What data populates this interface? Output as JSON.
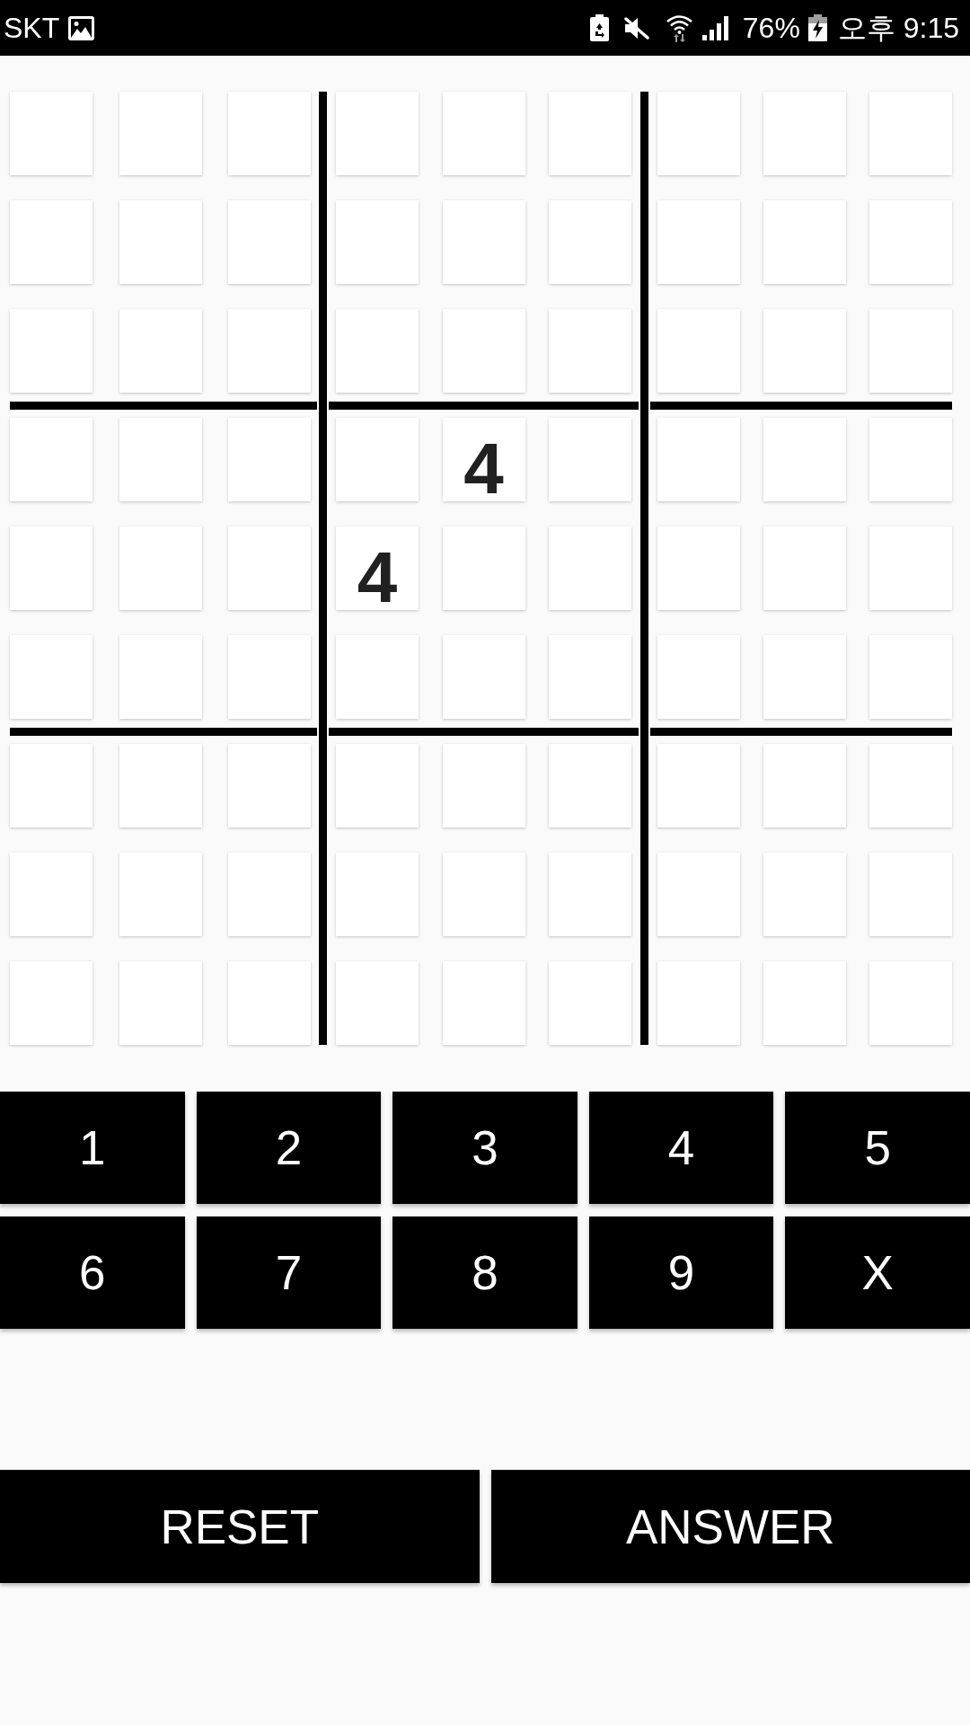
{
  "status_bar": {
    "carrier": "SKT",
    "battery_percent": "76%",
    "time": "오후 9:15"
  },
  "board": {
    "rows": [
      {
        "cells": [
          {
            "kind": "empty"
          },
          {
            "kind": "empty"
          },
          {
            "kind": "empty"
          },
          {
            "kind": "empty"
          },
          {
            "kind": "empty"
          },
          {
            "kind": "empty"
          },
          {
            "kind": "empty"
          },
          {
            "kind": "empty"
          },
          {
            "kind": "empty"
          }
        ]
      },
      {
        "cells": [
          {
            "kind": "empty"
          },
          {
            "kind": "empty"
          },
          {
            "kind": "empty"
          },
          {
            "kind": "empty"
          },
          {
            "kind": "empty"
          },
          {
            "kind": "empty"
          },
          {
            "kind": "empty"
          },
          {
            "kind": "empty"
          },
          {
            "kind": "empty"
          }
        ]
      },
      {
        "cells": [
          {
            "kind": "empty"
          },
          {
            "kind": "empty"
          },
          {
            "kind": "empty"
          },
          {
            "kind": "empty"
          },
          {
            "kind": "empty"
          },
          {
            "kind": "empty"
          },
          {
            "kind": "empty"
          },
          {
            "kind": "empty"
          },
          {
            "kind": "empty"
          }
        ]
      },
      {
        "cells": [
          {
            "kind": "empty"
          },
          {
            "kind": "empty"
          },
          {
            "kind": "empty"
          },
          {
            "kind": "empty"
          },
          {
            "kind": "given",
            "value": "4"
          },
          {
            "kind": "empty"
          },
          {
            "kind": "empty"
          },
          {
            "kind": "empty"
          },
          {
            "kind": "empty"
          }
        ]
      },
      {
        "cells": [
          {
            "kind": "empty"
          },
          {
            "kind": "empty"
          },
          {
            "kind": "empty"
          },
          {
            "kind": "given",
            "value": "4"
          },
          {
            "kind": "empty"
          },
          {
            "kind": "empty"
          },
          {
            "kind": "empty"
          },
          {
            "kind": "empty"
          },
          {
            "kind": "empty"
          }
        ]
      },
      {
        "cells": [
          {
            "kind": "empty"
          },
          {
            "kind": "empty"
          },
          {
            "kind": "empty"
          },
          {
            "kind": "empty"
          },
          {
            "kind": "empty"
          },
          {
            "kind": "empty"
          },
          {
            "kind": "empty"
          },
          {
            "kind": "empty"
          },
          {
            "kind": "empty"
          }
        ]
      },
      {
        "cells": [
          {
            "kind": "empty"
          },
          {
            "kind": "empty"
          },
          {
            "kind": "empty"
          },
          {
            "kind": "empty"
          },
          {
            "kind": "empty"
          },
          {
            "kind": "empty"
          },
          {
            "kind": "empty"
          },
          {
            "kind": "empty"
          },
          {
            "kind": "empty"
          }
        ]
      },
      {
        "cells": [
          {
            "kind": "empty"
          },
          {
            "kind": "empty"
          },
          {
            "kind": "empty"
          },
          {
            "kind": "empty"
          },
          {
            "kind": "empty"
          },
          {
            "kind": "empty"
          },
          {
            "kind": "empty"
          },
          {
            "kind": "empty"
          },
          {
            "kind": "empty"
          }
        ]
      },
      {
        "cells": [
          {
            "kind": "empty"
          },
          {
            "kind": "empty"
          },
          {
            "kind": "empty"
          },
          {
            "kind": "empty"
          },
          {
            "kind": "empty"
          },
          {
            "kind": "empty"
          },
          {
            "kind": "empty"
          },
          {
            "kind": "empty"
          },
          {
            "kind": "empty"
          }
        ]
      }
    ]
  },
  "keypad": {
    "keys": [
      "1",
      "2",
      "3",
      "4",
      "5",
      "6",
      "7",
      "8",
      "9",
      "X"
    ]
  },
  "actions": {
    "buttons": [
      "RESET",
      "ANSWER"
    ]
  }
}
